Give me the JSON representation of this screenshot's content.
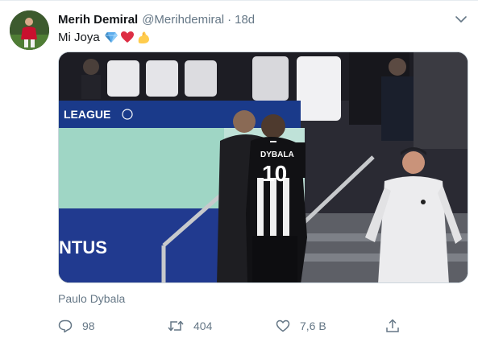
{
  "tweet": {
    "author_name": "Merih Demiral",
    "author_handle": "@Merihdemiral",
    "separator": "·",
    "timestamp": "18d",
    "text": "Mi Joya",
    "emojis": [
      "gem-emoji",
      "red-heart-emoji",
      "flexed-biceps-emoji"
    ],
    "tagged_people": "Paulo Dybala",
    "media_alt": "photo",
    "photo_visible_text": {
      "board": "LEAGUE",
      "board_bottom": "NTUS",
      "jersey_name": "DYBALA",
      "jersey_number": "10"
    }
  },
  "actions": {
    "reply_count": "98",
    "retweet_count": "404",
    "like_count": "7,6 B",
    "icons": [
      "reply-icon",
      "retweet-icon",
      "like-icon",
      "share-icon"
    ]
  },
  "colors": {
    "secondary_text": "#657786",
    "primary_text": "#14171a",
    "border": "#e6ecf0"
  }
}
